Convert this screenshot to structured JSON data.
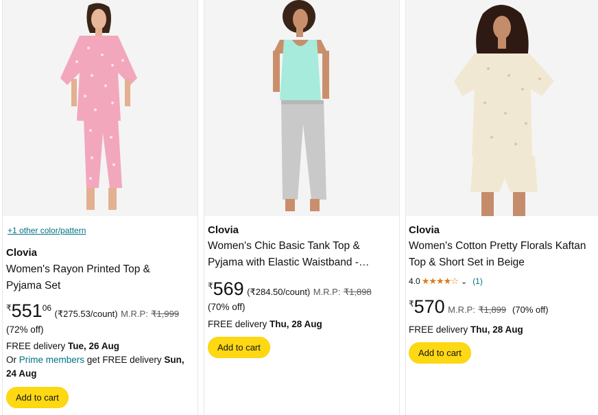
{
  "products": [
    {
      "swatch_link": "+1 other color/pattern",
      "brand": "Clovia",
      "title_lines": [
        "Women's Rayon Printed Top &",
        "Pyjama Set"
      ],
      "currency": "₹",
      "price_whole": "551",
      "price_fraction": "06",
      "per_count": "(₹275.53/count)",
      "mrp_label": "M.R.P:",
      "mrp": "₹1,999",
      "discount": "(72% off)",
      "delivery_prefix": "FREE delivery",
      "delivery_date": "Tue, 26 Aug",
      "prime_prefix": "Or",
      "prime_link": "Prime members",
      "prime_suffix": "get FREE delivery",
      "prime_date_1": "Sun,",
      "prime_date_2": "24 Aug",
      "button": "Add to cart",
      "image": "model-pink-floral-kaftan-pyjama-icon"
    },
    {
      "brand": "Clovia",
      "title_lines": [
        "Women's Chic Basic Tank Top &",
        "Pyjama with Elastic Waistband -…"
      ],
      "currency": "₹",
      "price_whole": "569",
      "per_count": "(₹284.50/count)",
      "mrp_label": "M.R.P:",
      "mrp": "₹1,898",
      "discount": "(70% off)",
      "delivery_prefix": "FREE delivery",
      "delivery_date": "Thu, 28 Aug",
      "button": "Add to cart",
      "image": "model-mint-tank-grey-pyjama-icon"
    },
    {
      "brand": "Clovia",
      "title_lines": [
        "Women's Cotton Pretty Florals Kaftan",
        "Top & Short Set in Beige"
      ],
      "rating_value": "4.0",
      "stars": "★★★★☆",
      "rating_count": "(1)",
      "currency": "₹",
      "price_whole": "570",
      "mrp_label": "M.R.P:",
      "mrp": "₹1,899",
      "discount": "(70% off)",
      "delivery_prefix": "FREE delivery",
      "delivery_date": "Thu, 28 Aug",
      "button": "Add to cart",
      "image": "model-beige-kaftan-shorts-icon"
    }
  ],
  "colors": {
    "button_bg": "#ffd814",
    "link": "#007185",
    "star": "#de7921",
    "muted": "#565959"
  }
}
